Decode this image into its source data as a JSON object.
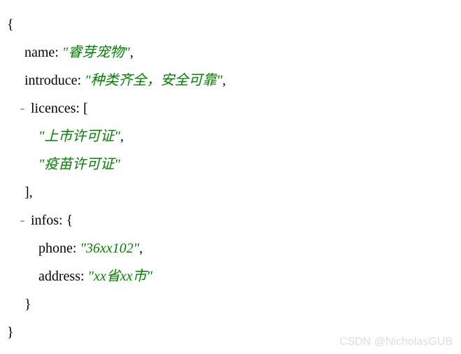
{
  "json": {
    "open_brace": "{",
    "close_brace": "}",
    "open_bracket": "[",
    "close_bracket": "]",
    "comma": ",",
    "colon": ":",
    "quote": "\"",
    "collapse": "-",
    "keys": {
      "name": "name",
      "introduce": "introduce",
      "licences": "licences",
      "infos": "infos",
      "phone": "phone",
      "address": "address"
    },
    "values": {
      "name": "睿芽宠物",
      "introduce": "种类齐全，安全可靠",
      "licences": [
        "上市许可证",
        "疫苗许可证"
      ],
      "phone": "36xx102",
      "address": "xx省xx市"
    }
  },
  "watermark": "CSDN @NicholasGUB"
}
